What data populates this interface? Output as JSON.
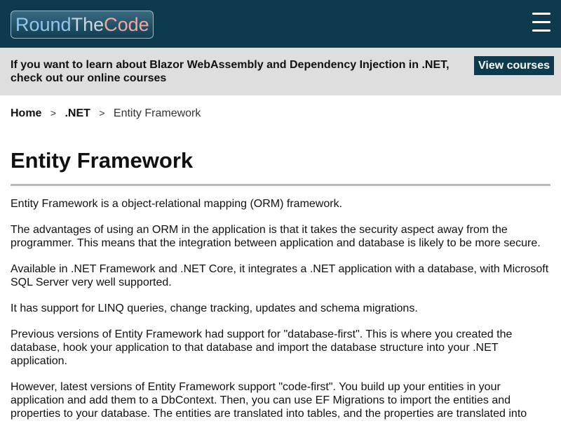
{
  "header": {
    "logo": {
      "part1": "Round",
      "part2": "The",
      "part3": "Code"
    },
    "menu_icon": "hamburger-menu-icon",
    "colors": {
      "background": "#0e3a4d"
    }
  },
  "promo": {
    "text": "If you want to learn about Blazor WebAssembly and Dependency Injection in .NET, check out our online courses",
    "button_label": "View courses",
    "colors": {
      "background": "#dedede",
      "button": "#0e3a4d"
    }
  },
  "breadcrumb": {
    "items": [
      {
        "label": "Home"
      },
      {
        "label": ".NET"
      },
      {
        "label": "Entity Framework"
      }
    ],
    "separator": ">"
  },
  "main": {
    "title": "Entity Framework",
    "paragraphs": [
      "Entity Framework is a object-relational mapping (ORM) framework.",
      "The advantages of using an ORM in the application is that it takes the security aspect away from the programmer. This means that the integration between application and database is likely to be more secure.",
      "Available in .NET Framework and .NET Core, it integrates a .NET application with a database, with Microsoft SQL Server very well supported.",
      "It has support for LINQ queries, change tracking, updates and schema migrations.",
      "Previous versions of Entity Framework had support for \"database-first\". This is where you created the database, hook your application to that database and import the database structure into your .NET application.",
      "However, latest versions of Entity Framework support \"code-first\". You build up your entities in your application and add them to a DbContext. Then, you can use EF Migrations to import the entities and properties to your database. The entities are translated into tables, and the properties are translated into"
    ]
  }
}
